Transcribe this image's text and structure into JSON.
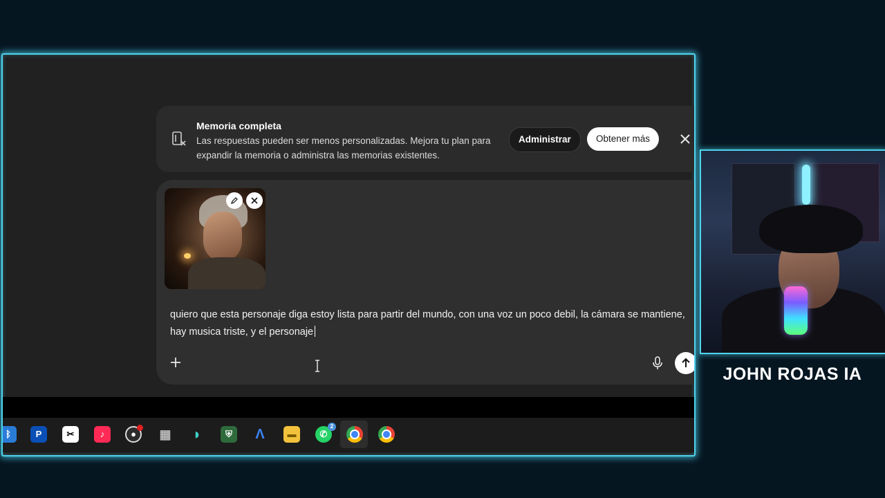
{
  "banner": {
    "title": "Memoria completa",
    "description": "Las respuestas pueden ser menos personalizadas. Mejora tu plan para expandir la memoria o administra las memorias existentes.",
    "manage_label": "Administrar",
    "get_more_label": "Obtener más"
  },
  "composer": {
    "prompt_text": "quiero que esta personaje diga estoy lista para partir del mundo, con una voz un poco debil, la cámara se  mantiene, hay musica triste, y el personaje",
    "attachment_icon": "elderly-woman-portrait",
    "edit_icon": "pencil-icon",
    "remove_icon": "close-icon"
  },
  "taskbar": {
    "icons": [
      "bluetooth-icon",
      "playstation-icon",
      "capcut-icon",
      "tiktok-icon",
      "obs-icon",
      "apps-grid-icon",
      "edge-dev-icon",
      "shield-game-icon",
      "arc-icon",
      "file-explorer-icon",
      "whatsapp-icon",
      "chrome-icon",
      "chrome-profile-icon"
    ],
    "whatsapp_badge": "2"
  },
  "overlay": {
    "streamer_name": "JOHN ROJAS IA",
    "accent_color": "#4fd4ef"
  }
}
